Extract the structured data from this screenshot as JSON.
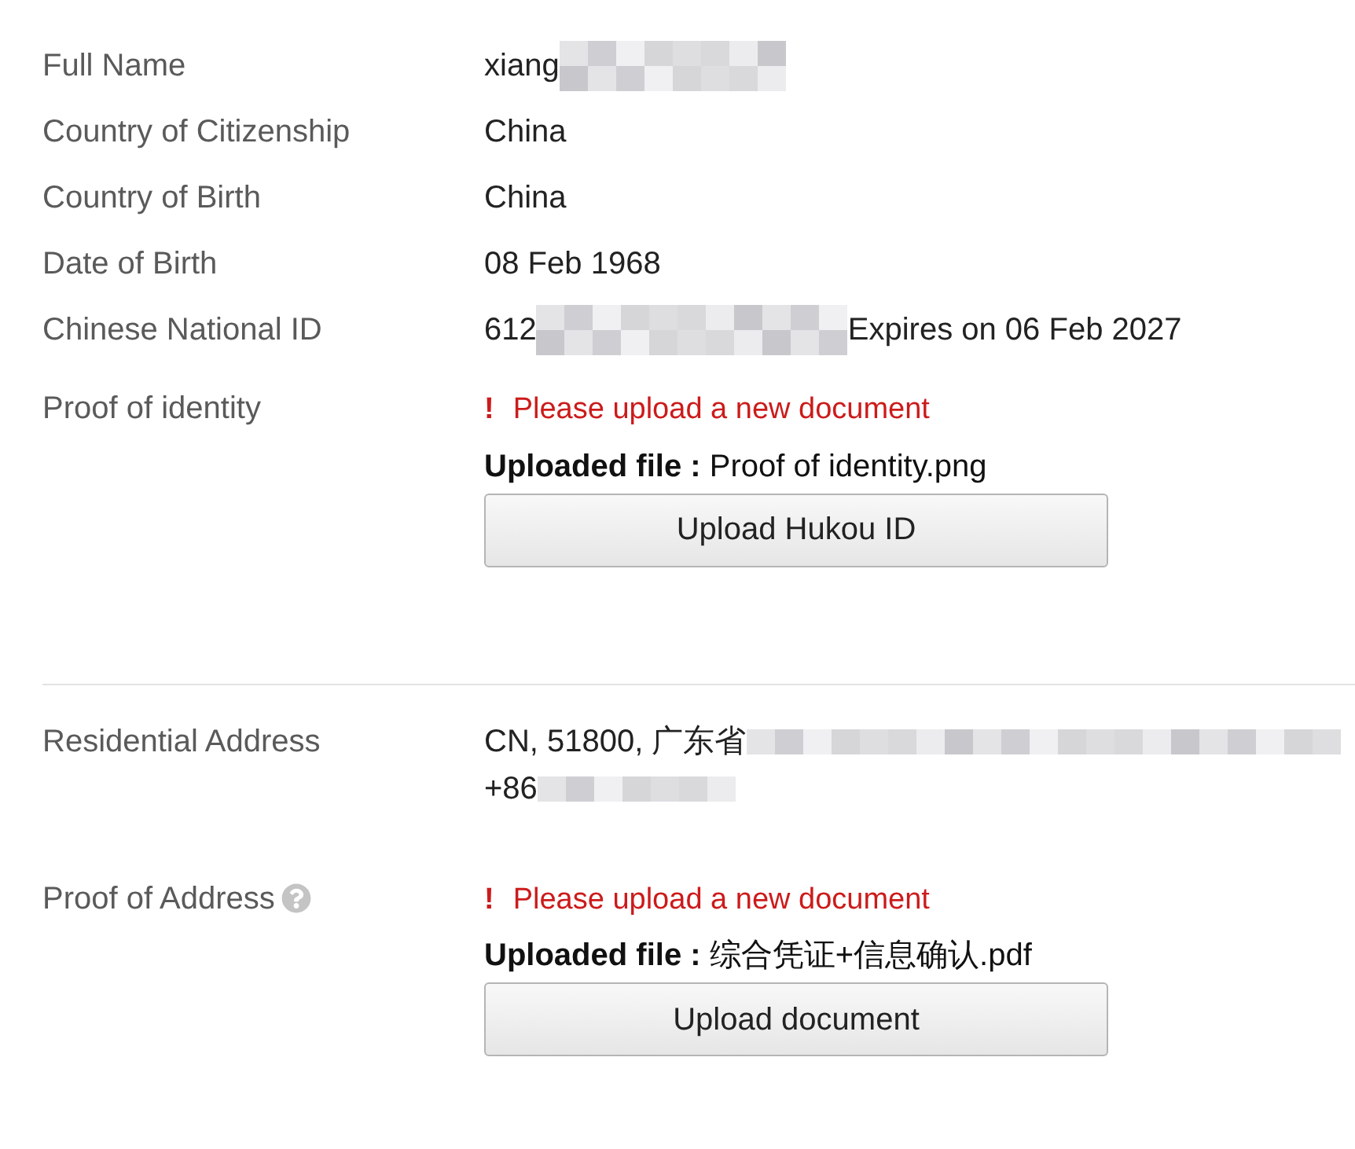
{
  "identity": {
    "rows": [
      {
        "kind": "text",
        "label": "Full Name",
        "value": "xiang",
        "redacted": true
      },
      {
        "kind": "text",
        "label": "Country of Citizenship",
        "value": "China",
        "redacted": false
      },
      {
        "kind": "text",
        "label": "Country of Birth",
        "value": "China",
        "redacted": false
      },
      {
        "kind": "text",
        "label": "Date of Birth",
        "value": "08 Feb 1968",
        "redacted": false
      },
      {
        "kind": "text",
        "label": "Chinese National ID",
        "value": "612",
        "redacted": true,
        "suffix": "Expires on 06 Feb 2027"
      },
      {
        "kind": "upload",
        "label": "Proof of identity",
        "help": false,
        "error_icon": "!",
        "error": "Please upload a new document",
        "file_label": "Uploaded file :",
        "file_name": "Proof of identity.png",
        "button": "Upload Hukou ID"
      }
    ]
  },
  "address": {
    "rows": [
      {
        "kind": "address",
        "label": "Residential Address",
        "lines": [
          {
            "value": "CN, 51800, 广东省",
            "redacted": true
          },
          {
            "value": "+86",
            "redacted": true
          }
        ]
      },
      {
        "kind": "upload",
        "label": "Proof of Address",
        "help": true,
        "error_icon": "!",
        "error": "Please upload a new document",
        "file_label": "Uploaded file :",
        "file_name": "综合凭证+信息确认.pdf",
        "button": "Upload document"
      }
    ]
  }
}
